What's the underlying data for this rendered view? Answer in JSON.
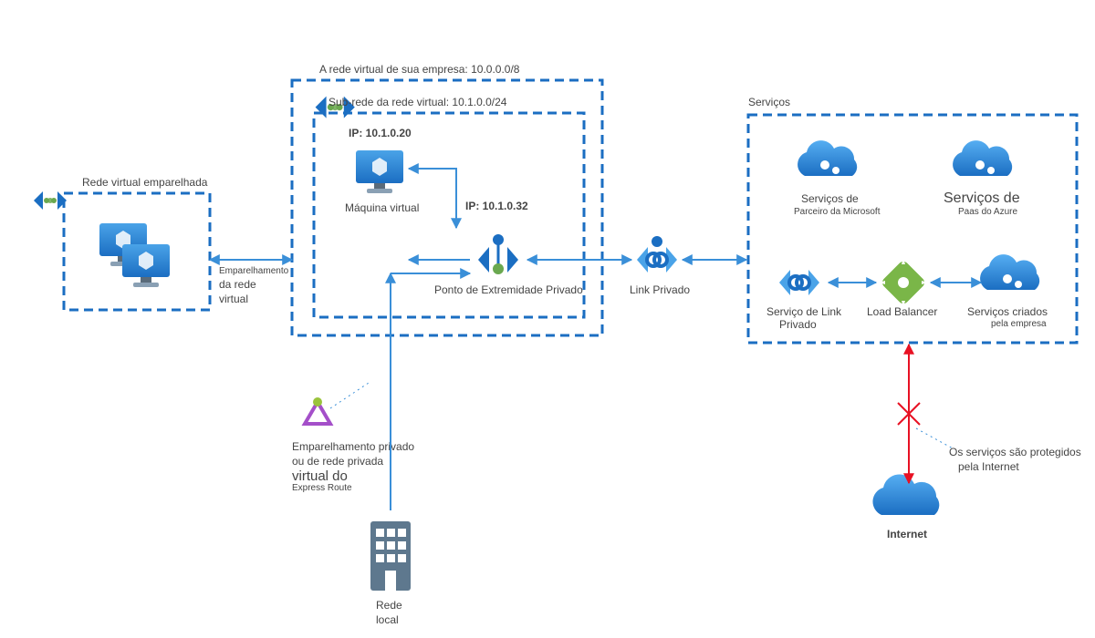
{
  "peeredVnet": {
    "title": "Rede virtual emparelhada"
  },
  "vnetPeeringLabel": {
    "l1": "Emparelhamento",
    "l2": "da rede",
    "l3": "virtual"
  },
  "companyVnet": {
    "title": "A rede virtual de sua empresa: 10.0.0.0/8"
  },
  "subnet": {
    "title": "Sub-rede da rede virtual: 10.1.0.0/24"
  },
  "vm": {
    "ip": "IP: 10.1.0.20",
    "caption": "Máquina virtual"
  },
  "privateEndpoint": {
    "ip": "IP: 10.1.0.32",
    "caption": "Ponto de Extremidade Privado"
  },
  "privateLink": {
    "caption": "Link Privado"
  },
  "expressRoute": {
    "l1": "Emparelhamento privado",
    "l2": "ou de rede privada",
    "l3": "virtual do",
    "l4": "Express Route"
  },
  "onPrem": {
    "l1": "Rede",
    "l2": "local"
  },
  "services": {
    "title": "Serviços",
    "partners": {
      "l1": "Serviços de",
      "l2": "Parceiro da Microsoft"
    },
    "paas": {
      "l1": "Serviços de",
      "l2": "Paas do Azure"
    },
    "pls": {
      "l1": "Serviço de Link",
      "l2": "Privado"
    },
    "lb": {
      "caption": "Load Balancer"
    },
    "customer": {
      "l1": "Serviços criados",
      "l2": "pela empresa"
    }
  },
  "internet": {
    "caption": "Internet",
    "note1": "Os serviços são protegidos",
    "note2": "pela Internet"
  }
}
